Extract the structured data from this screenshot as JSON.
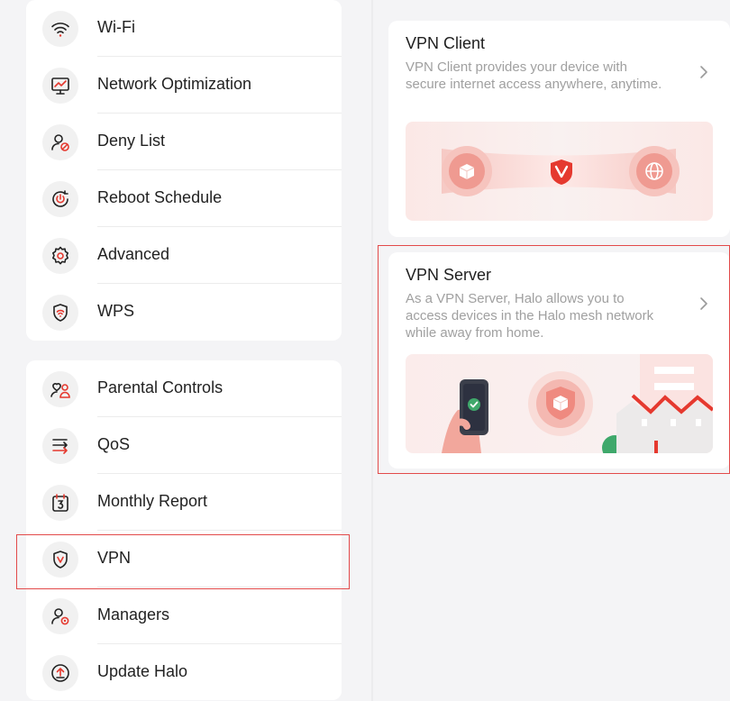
{
  "menu": {
    "group1": [
      {
        "label": "Wi-Fi",
        "icon": "wifi-icon"
      },
      {
        "label": "Network Optimization",
        "icon": "network-optimization-icon"
      },
      {
        "label": "Deny List",
        "icon": "deny-list-icon"
      },
      {
        "label": "Reboot Schedule",
        "icon": "reboot-schedule-icon"
      },
      {
        "label": "Advanced",
        "icon": "gear-icon"
      },
      {
        "label": "WPS",
        "icon": "wps-icon"
      }
    ],
    "group2": [
      {
        "label": "Parental Controls",
        "icon": "parental-controls-icon"
      },
      {
        "label": "QoS",
        "icon": "qos-icon"
      },
      {
        "label": "Monthly Report",
        "icon": "monthly-report-icon"
      },
      {
        "label": "VPN",
        "icon": "vpn-shield-icon"
      },
      {
        "label": "Managers",
        "icon": "managers-icon"
      },
      {
        "label": "Update Halo",
        "icon": "update-icon"
      }
    ]
  },
  "vpn_client": {
    "title": "VPN Client",
    "description": "VPN Client provides your device with secure internet access anywhere, anytime."
  },
  "vpn_server": {
    "title": "VPN Server",
    "description": "As a VPN Server, Halo allows you to access devices in the Halo mesh network while away from home."
  },
  "colors": {
    "accent": "#e5392f",
    "highlight_border": "#e24a4a",
    "background": "#f4f4f6",
    "card": "#ffffff",
    "secondary_text": "#a0a0a0"
  }
}
